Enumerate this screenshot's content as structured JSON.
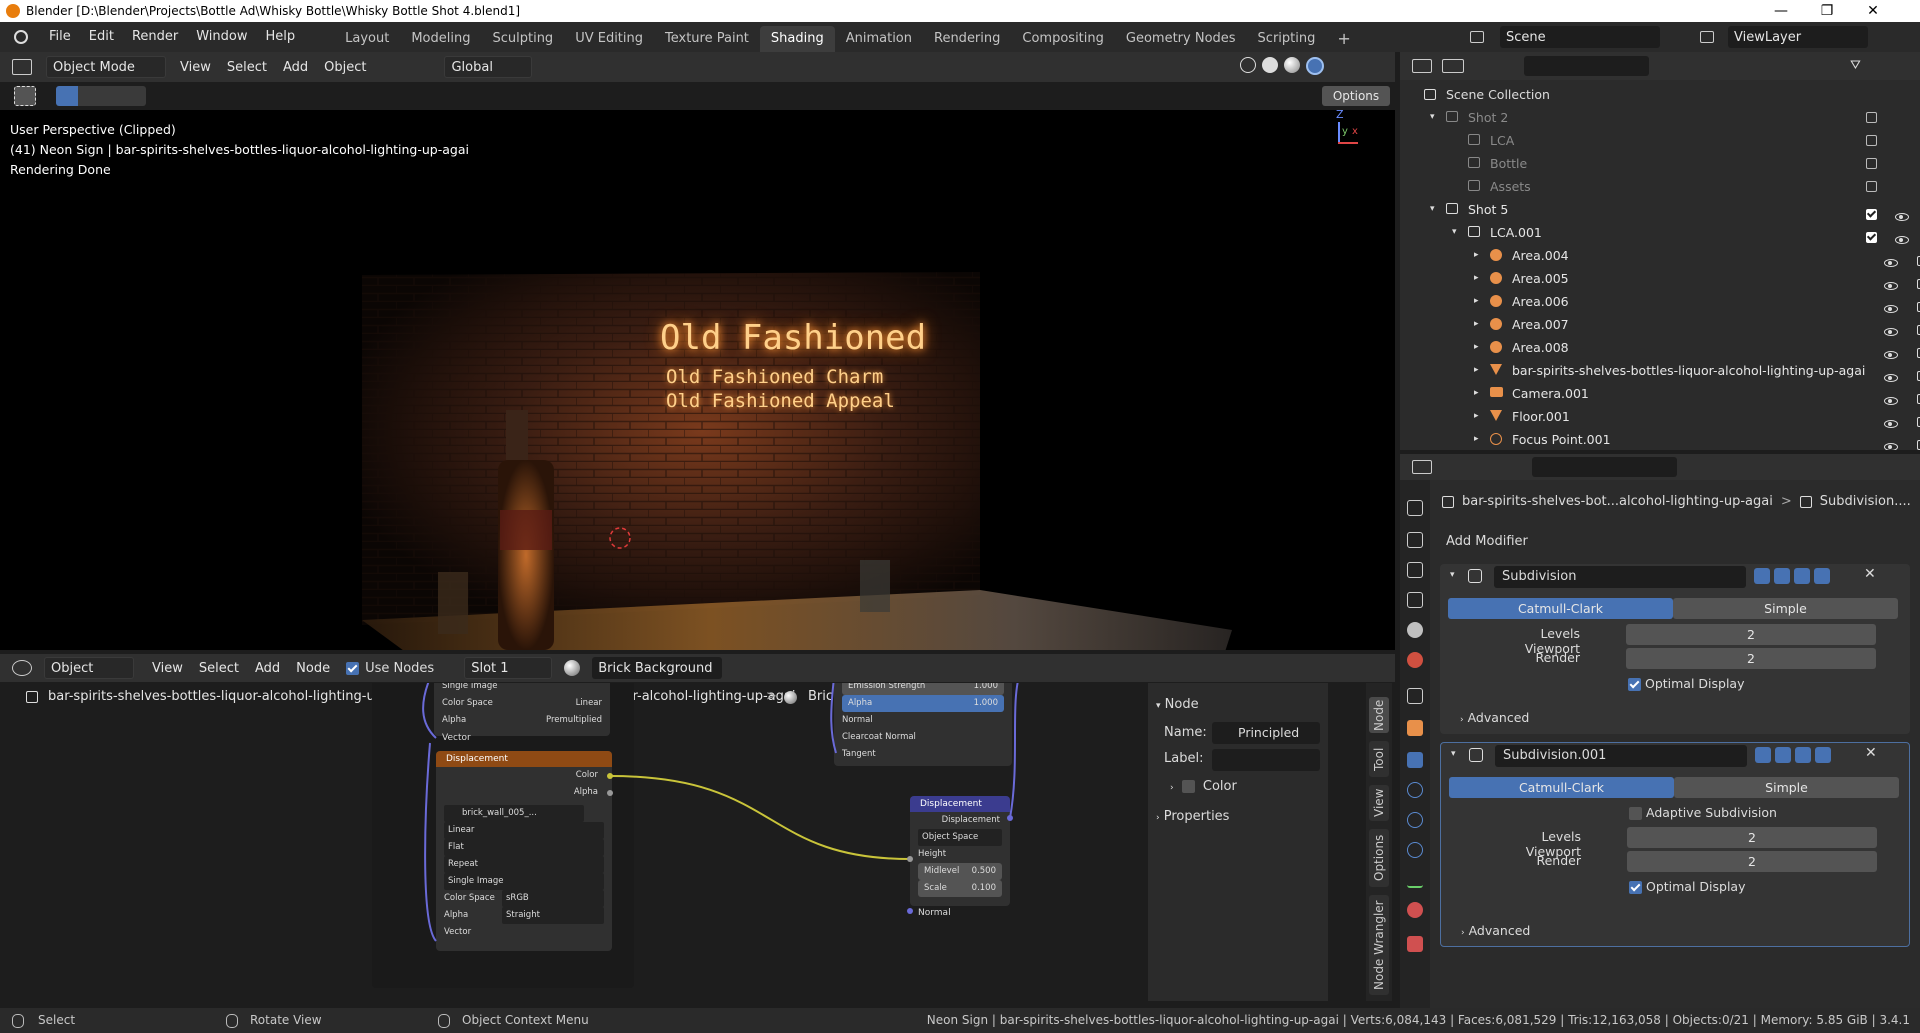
{
  "window": {
    "title": "Blender [D:\\Blender\\Projects\\Bottle Ad\\Whisky Bottle\\Whisky Bottle Shot 4.blend1]",
    "minimize": "—",
    "maximize": "❐",
    "close": "✕"
  },
  "menus": [
    "File",
    "Edit",
    "Render",
    "Window",
    "Help"
  ],
  "workspaces": [
    "Layout",
    "Modeling",
    "Sculpting",
    "UV Editing",
    "Texture Paint",
    "Shading",
    "Animation",
    "Rendering",
    "Compositing",
    "Geometry Nodes",
    "Scripting"
  ],
  "active_workspace": "Shading",
  "add_workspace": "+",
  "scene": {
    "label": "Scene",
    "viewlayer": "ViewLayer"
  },
  "viewport_header": {
    "mode": "Object Mode",
    "menus": [
      "View",
      "Select",
      "Add",
      "Object"
    ],
    "transform": "Global",
    "options": "Options"
  },
  "viewport": {
    "perspective": "User Perspective (Clipped)",
    "object": "(41) Neon Sign | bar-spirits-shelves-bottles-liquor-alcohol-lighting-up-agai",
    "status": "Rendering Done",
    "neon_line1": "Old Fashioned",
    "neon_line2": "Old Fashioned Charm",
    "neon_line3": "Old Fashioned Appeal",
    "axis_z": "Z",
    "axis_y": "y",
    "axis_x": "x"
  },
  "node_header": {
    "editor": "Object",
    "menus": [
      "View",
      "Select",
      "Add",
      "Node"
    ],
    "use_nodes": "Use Nodes",
    "slot": "Slot 1",
    "material": "Brick Background"
  },
  "node_breadcrumb": {
    "object": "bar-spirits-shelves-bottles-liquor-alcohol-lighting-up-agai",
    "mesh": "bar-spirits-shelves-bottles-liquor-alcohol-lighting-up-agai",
    "material": "Brick Background"
  },
  "nodes": {
    "top_partial": {
      "r1": "Single Image",
      "r2": "Color Space",
      "r2v": "Linear",
      "r3": "Alpha",
      "r3v": "Premultiplied",
      "r4": "Vector"
    },
    "image_node": {
      "header": "Displacement",
      "out_color": "Color",
      "out_alpha": "Alpha",
      "image": "brick_wall_005_...",
      "interp": "Linear",
      "proj": "Flat",
      "ext": "Repeat",
      "source": "Single Image",
      "cs_label": "Color Space",
      "cs_value": "sRGB",
      "alpha_label": "Alpha",
      "alpha_value": "Straight",
      "vector": "Vector"
    },
    "bsdf_partial": {
      "emission_strength": "Emission Strength",
      "emission_value": "1.000",
      "alpha_label": "Alpha",
      "alpha_value": "1.000",
      "normal": "Normal",
      "clearcoat_normal": "Clearcoat Normal",
      "tangent": "Tangent"
    },
    "displacement_node": {
      "header": "Displacement",
      "out": "Displacement",
      "space": "Object Space",
      "height": "Height",
      "midlevel": "Midlevel",
      "midlevel_value": "0.500",
      "scale": "Scale",
      "scale_value": "0.100",
      "normal": "Normal"
    }
  },
  "node_sidebar": {
    "section": "Node",
    "name_label": "Name:",
    "name_value": "Principled BSDF",
    "label_label": "Label:",
    "label_value": "",
    "color": "Color",
    "properties": "Properties",
    "tabs": [
      "Node",
      "Tool",
      "View",
      "Options",
      "Node Wrangler"
    ]
  },
  "outliner": {
    "root": "Scene Collection",
    "rows": [
      {
        "name": "Shot 2",
        "indent": 1,
        "type": "collection",
        "dim": true
      },
      {
        "name": "LCA",
        "indent": 2,
        "type": "collection",
        "dim": true
      },
      {
        "name": "Bottle",
        "indent": 2,
        "type": "collection",
        "dim": true
      },
      {
        "name": "Assets",
        "indent": 2,
        "type": "collection",
        "dim": true
      },
      {
        "name": "Shot 5",
        "indent": 1,
        "type": "collection",
        "dim": false
      },
      {
        "name": "LCA.001",
        "indent": 2,
        "type": "collection",
        "dim": false
      },
      {
        "name": "Area.004",
        "indent": 3,
        "type": "light",
        "dim": false
      },
      {
        "name": "Area.005",
        "indent": 3,
        "type": "light",
        "dim": false
      },
      {
        "name": "Area.006",
        "indent": 3,
        "type": "light",
        "dim": false
      },
      {
        "name": "Area.007",
        "indent": 3,
        "type": "light",
        "dim": false
      },
      {
        "name": "Area.008",
        "indent": 3,
        "type": "light",
        "dim": false
      },
      {
        "name": "bar-spirits-shelves-bottles-liquor-alcohol-lighting-up-agai",
        "indent": 3,
        "type": "mesh",
        "dim": false
      },
      {
        "name": "Camera.001",
        "indent": 3,
        "type": "camera",
        "dim": false
      },
      {
        "name": "Floor.001",
        "indent": 3,
        "type": "mesh",
        "dim": false
      },
      {
        "name": "Focus Point.001",
        "indent": 3,
        "type": "empty",
        "dim": false
      }
    ]
  },
  "properties": {
    "breadcrumb_object": "bar-spirits-shelves-bot...alcohol-lighting-up-agai",
    "breadcrumb_modifier": "Subdivision....",
    "add_modifier": "Add Modifier",
    "mod1": {
      "name": "Subdivision",
      "tab_a": "Catmull-Clark",
      "tab_b": "Simple",
      "levels_label": "Levels Viewport",
      "levels_value": "2",
      "render_label": "Render",
      "render_value": "2",
      "optimal": "Optimal Display",
      "advanced": "Advanced"
    },
    "mod2": {
      "name": "Subdivision.001",
      "tab_a": "Catmull-Clark",
      "tab_b": "Simple",
      "adaptive": "Adaptive Subdivision",
      "levels_label": "Levels Viewport",
      "levels_value": "2",
      "render_label": "Render",
      "render_value": "2",
      "optimal": "Optimal Display",
      "advanced": "Advanced"
    }
  },
  "statusbar": {
    "select": "Select",
    "rotate": "Rotate View",
    "context": "Object Context Menu",
    "info": "Neon Sign | bar-spirits-shelves-bottles-liquor-alcohol-lighting-up-agai | Verts:6,084,143 | Faces:6,081,529 | Tris:12,163,058 | Objects:0/21 | Memory: 5.85 GiB | 3.4.1"
  },
  "colors": {
    "accent": "#4772b3",
    "node_orange": "#8f4a14",
    "node_blue": "#3b3c8f",
    "neon": "#ffb45a"
  }
}
